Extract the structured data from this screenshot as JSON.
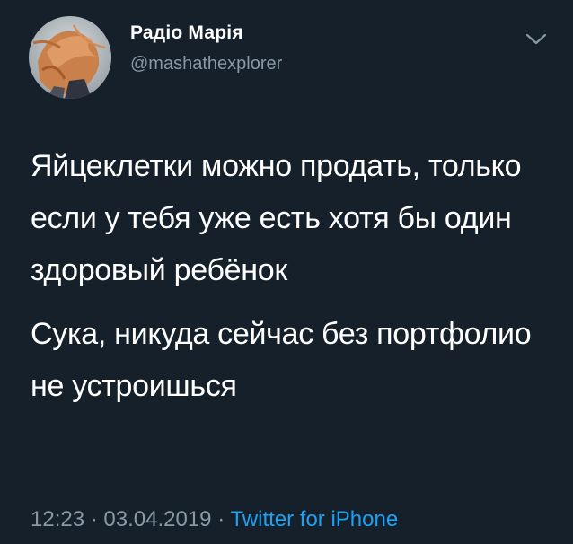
{
  "author": {
    "display_name": "Радіо Марія",
    "handle": "@mashathexplorer"
  },
  "tweet": {
    "paragraph1": "Яйцеклетки можно продать, только если у тебя уже есть хотя бы один здоровый ребёнок",
    "paragraph2": "Сука, никуда сейчас без портфолио не устроишься"
  },
  "meta": {
    "time": "12:23",
    "separator1": "·",
    "date": "03.04.2019",
    "separator2": "·",
    "source": "Twitter for iPhone"
  },
  "colors": {
    "background": "#15202b",
    "text": "#ffffff",
    "secondary_text": "#8899a6",
    "link": "#1da1f2"
  },
  "icons": {
    "more_menu": "chevron-down-icon",
    "profile_picture": "avatar"
  }
}
